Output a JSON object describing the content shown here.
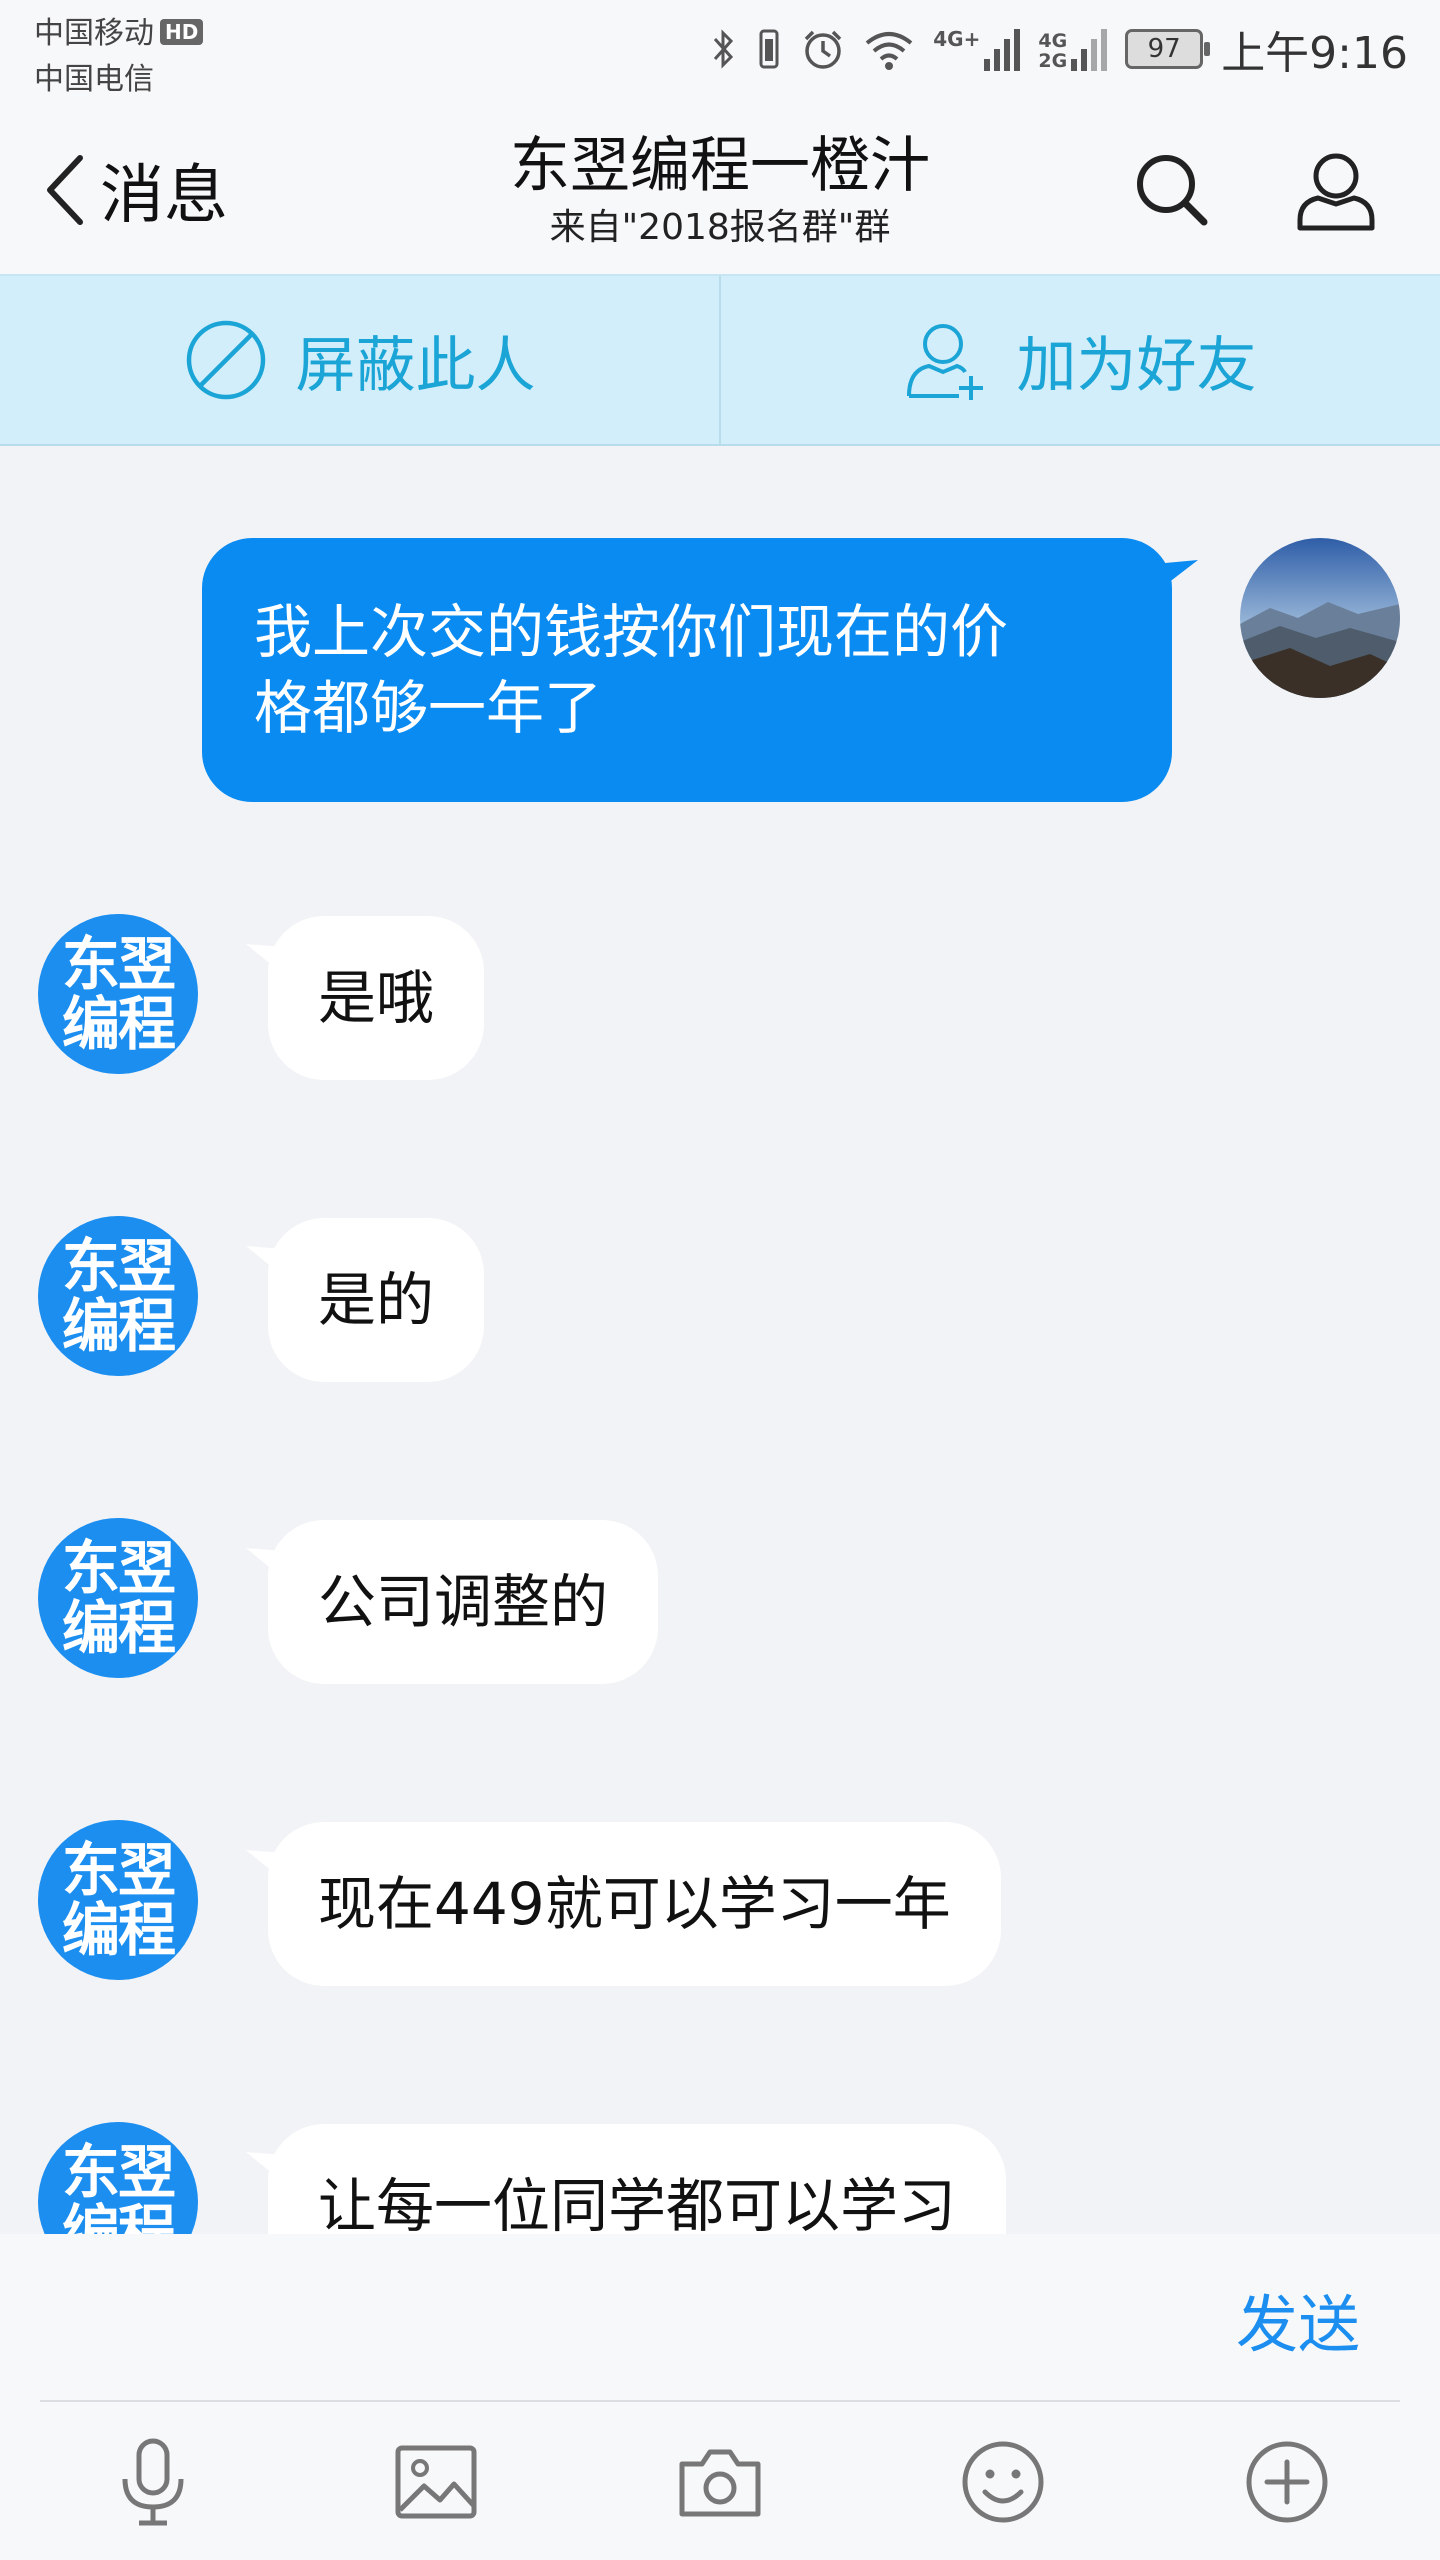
{
  "status_bar": {
    "carrier_1": "中国移动",
    "hd_badge": "HD",
    "carrier_2": "中国电信",
    "network_1": "4G+",
    "network_2a": "4G",
    "network_2b": "2G",
    "battery": "97",
    "time": "上午9:16"
  },
  "header": {
    "back_label": "消息",
    "title": "东翌编程一橙汁",
    "subtitle": "来自\"2018报名群\"群"
  },
  "actions": {
    "block_label": "屏蔽此人",
    "add_friend_label": "加为好友"
  },
  "contact": {
    "avatar_line1": "东翌",
    "avatar_line2": "编程"
  },
  "messages": [
    {
      "from": "me",
      "text": "我上次交的钱按你们现在的价\n格都够一年了"
    },
    {
      "from": "other",
      "text": "是哦"
    },
    {
      "from": "other",
      "text": "是的"
    },
    {
      "from": "other",
      "text": "公司调整的"
    },
    {
      "from": "other",
      "text": "现在449就可以学习一年"
    },
    {
      "from": "other",
      "text": "让每一位同学都可以学习"
    }
  ],
  "input": {
    "send_label": "发送"
  },
  "colors": {
    "accent": "#0a8bf2",
    "action_bar": "#d2eefa",
    "action_text": "#1ba4d6",
    "background": "#f2f3f6"
  },
  "icons": {
    "back": "chevron-left-icon",
    "search": "search-icon",
    "profile": "person-icon",
    "block": "block-icon",
    "add_friend": "add-person-icon",
    "tools": [
      "microphone-icon",
      "image-icon",
      "camera-icon",
      "emoji-icon",
      "plus-icon"
    ]
  }
}
